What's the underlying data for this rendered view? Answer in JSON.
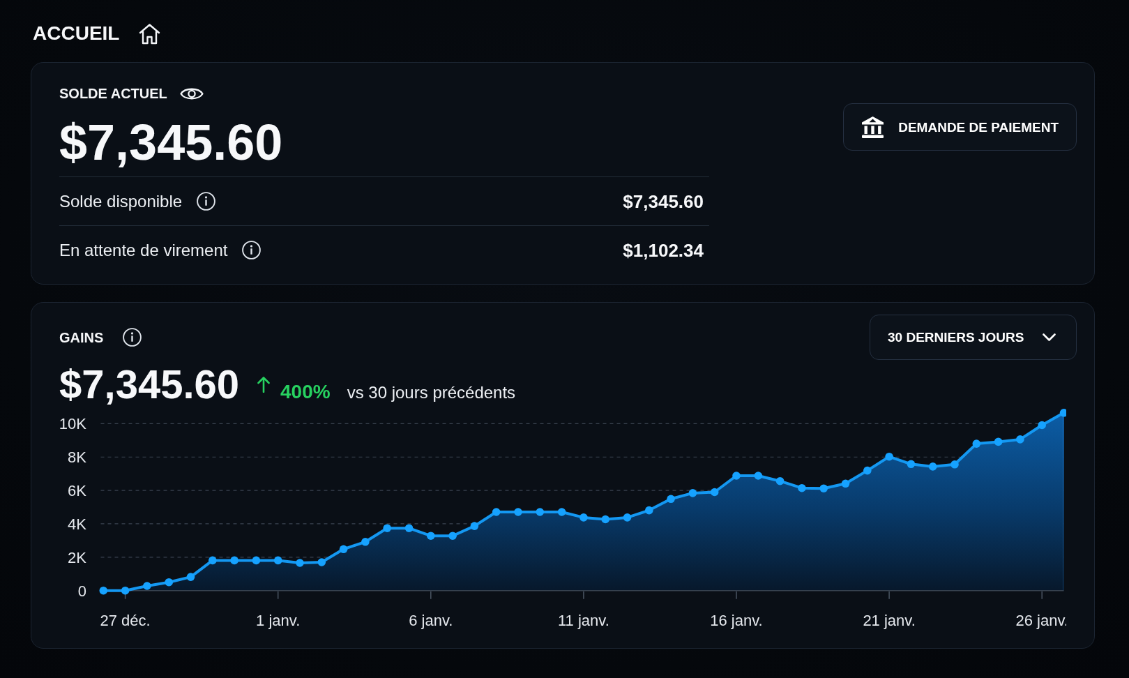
{
  "page": {
    "title": "ACCUEIL"
  },
  "balance_card": {
    "title": "SOLDE ACTUEL",
    "amount": "$7,345.60",
    "rows": [
      {
        "label": "Solde disponible",
        "value": "$7,345.60"
      },
      {
        "label": "En attente de virement",
        "value": "$1,102.34"
      }
    ],
    "payout_button": {
      "label": "DEMANDE DE PAIEMENT"
    }
  },
  "earnings_card": {
    "title": "GAINS",
    "period_dropdown": {
      "value": "30 DERNIERS JOURS"
    },
    "amount": "$7,345.60",
    "change": {
      "increasing": true,
      "value": "400%",
      "comparison": "vs 30 jours précédents"
    },
    "chart_data": {
      "type": "area",
      "categories": [
        null,
        "27 déc.",
        null,
        null,
        null,
        null,
        null,
        null,
        "1 janv.",
        null,
        null,
        null,
        null,
        null,
        null,
        "6 janv.",
        null,
        null,
        null,
        null,
        null,
        null,
        "11 janv.",
        null,
        null,
        null,
        null,
        null,
        null,
        "16 janv.",
        null,
        null,
        null,
        null,
        null,
        null,
        "21 janv.",
        null,
        null,
        null,
        null,
        null,
        null,
        "26 janv.",
        null
      ],
      "values": [
        0,
        0,
        280,
        500,
        820,
        1810,
        1810,
        1810,
        1810,
        1660,
        1700,
        2480,
        2920,
        3740,
        3740,
        3280,
        3280,
        3870,
        4710,
        4710,
        4710,
        4710,
        4380,
        4270,
        4380,
        4810,
        5490,
        5840,
        5900,
        6880,
        6880,
        6560,
        6140,
        6120,
        6410,
        7190,
        8020,
        7580,
        7430,
        7560,
        8800,
        8910,
        9060,
        9910,
        10650
      ],
      "grid": true,
      "ylim": [
        0,
        10650
      ],
      "yticks": [
        {
          "value": 0,
          "label": "0"
        },
        {
          "value": 2000,
          "label": "2K"
        },
        {
          "value": 4000,
          "label": "4K"
        },
        {
          "value": 6000,
          "label": "6K"
        },
        {
          "value": 8000,
          "label": "8K"
        },
        {
          "value": 10000,
          "label": "10K"
        }
      ]
    }
  }
}
